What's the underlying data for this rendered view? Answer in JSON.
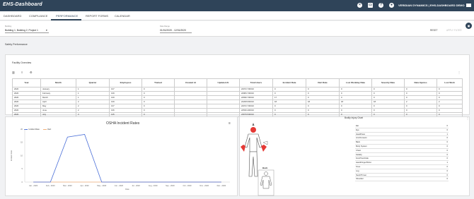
{
  "header": {
    "logo": "EHS-Dashboard",
    "user": "VERIDIAN DYNAMICS | EHS-DASHBOARD DEMO",
    "icons": [
      "close-icon",
      "folder-icon",
      "help-icon",
      "user-icon",
      "mail-icon"
    ]
  },
  "nav": {
    "tabs": [
      "DASHBOARD",
      "COMPLIANCE",
      "PERFORMANCE",
      "REPORT FORMS",
      "CALENDAR"
    ],
    "active": "PERFORMANCE"
  },
  "filters": {
    "building_label": "Building",
    "building_value": "Building 1, Building 2, Project 1",
    "date_label": "Date Range",
    "date_value": "01/01/2020 - 12/31/2020",
    "reset": "RESET",
    "apply": "APPLY FILTER"
  },
  "section": {
    "title": "Safety Performance"
  },
  "facility": {
    "title": "Facility Overview",
    "columns": [
      "Year",
      "Month",
      "Quarter",
      "Employees",
      "Trained",
      "Created At",
      "Updated At",
      "Total Hours",
      "Incident Rate",
      "Dart Rate",
      "Lost Workday Rate",
      "Severity Rate",
      "Data Injuries",
      "Lost Work"
    ],
    "rows": [
      [
        "2020",
        "January",
        "1",
        "137",
        "0",
        "",
        "",
        "22072.730010",
        "0",
        "0",
        "0",
        "0",
        "0",
        "0"
      ],
      [
        "2020",
        "February",
        "1",
        "139",
        "0",
        "",
        "",
        "22984.730010",
        "0",
        "0",
        "0",
        "0",
        "0",
        "0"
      ],
      [
        "2020",
        "March",
        "1",
        "139",
        "0",
        "",
        "",
        "22696.730010",
        "17",
        "0",
        "0",
        "0",
        "0",
        "0"
      ],
      [
        "2020",
        "April",
        "2",
        "139",
        "0",
        "",
        "",
        "22208.600010",
        "18",
        "18",
        "18",
        "18",
        "2",
        "2"
      ],
      [
        "2020",
        "May",
        "2",
        "137",
        "0",
        "",
        "",
        "22072.730010",
        "0",
        "0",
        "0",
        "0",
        "0",
        "0"
      ],
      [
        "2020",
        "June",
        "2",
        "136",
        "0",
        "",
        "",
        "22530.400010",
        "0",
        "0",
        "0",
        "0",
        "0",
        "0"
      ],
      [
        "2020",
        "July",
        "3",
        "145",
        "0",
        "",
        "",
        "23679.530010",
        "0",
        "0",
        "0",
        "0",
        "0",
        "0"
      ]
    ]
  },
  "osha": {
    "title": "OSHA Incident Rates",
    "legend": [
      "Incident Rate",
      "Dart"
    ],
    "ylabel": "Incident Rate",
    "xlabel": "Date"
  },
  "chart_data": {
    "type": "line",
    "title": "OSHA Incident Rates",
    "xlabel": "Date",
    "ylabel": "Incident Rate",
    "categories": [
      "Jan - 2020",
      "Feb - 2020",
      "Mar - 2020",
      "Apr - 2020",
      "May - 2020",
      "Jun - 2020",
      "Jul - 2020",
      "Aug - 2020",
      "Sep - 2020",
      "Oct - 2020",
      "Nov - 2020",
      "Dec - 2020"
    ],
    "yticks": [
      "0",
      "5",
      "10",
      "15",
      "20"
    ],
    "ylim": [
      0,
      20
    ],
    "series": [
      {
        "name": "Incident Rate",
        "color": "#4a6fd8",
        "values": [
          0,
          0,
          17,
          18,
          0,
          0,
          0,
          0,
          0,
          0,
          0,
          0
        ]
      },
      {
        "name": "Dart",
        "color": "#f2b07a",
        "values": [
          0,
          0,
          0,
          0,
          0,
          0,
          0,
          0,
          0,
          0,
          0,
          0
        ]
      }
    ],
    "grid": false,
    "legend_position": "top-left"
  },
  "injury": {
    "title": "Bodily Injury Chart",
    "back_label": "Back",
    "parts": [
      {
        "name": "Ear",
        "value": "0"
      },
      {
        "name": "Eye",
        "value": "0"
      },
      {
        "name": "Head/Face",
        "value": "1"
      },
      {
        "name": "Arm/Forearm",
        "value": "0"
      },
      {
        "name": "Back",
        "value": "0"
      },
      {
        "name": "Body System",
        "value": "0"
      },
      {
        "name": "Chest",
        "value": "0"
      },
      {
        "name": "Fatality",
        "value": "0"
      },
      {
        "name": "Foot/Toe/Ankle",
        "value": "0"
      },
      {
        "name": "Hand/Finger/Wrist",
        "value": "1"
      },
      {
        "name": "Knee",
        "value": "0"
      },
      {
        "name": "Leg",
        "value": "0"
      },
      {
        "name": "Neck/Throat",
        "value": "0"
      },
      {
        "name": "Shoulder",
        "value": "0"
      }
    ]
  }
}
